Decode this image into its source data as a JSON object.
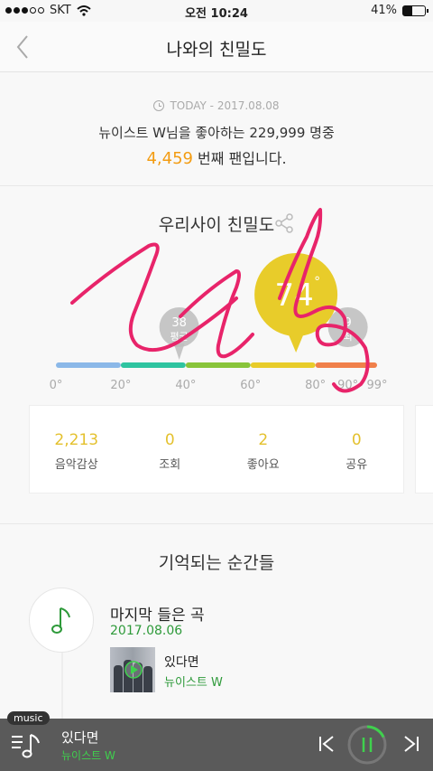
{
  "status_bar": {
    "carrier": "SKT",
    "time": "오전 10:24",
    "battery": "41%",
    "battery_level": 0.41
  },
  "nav": {
    "title": "나와의 친밀도",
    "back_icon": "back-icon"
  },
  "today": {
    "date": "TODAY - 2017.08.08",
    "line1": "뉴이스트 W님을 좋아하는 229,999 명중",
    "rank": "4,459",
    "line2_suffix": " 번째 팬입니다."
  },
  "intimacy": {
    "title": "우리사이 친밀도",
    "score": "74",
    "score_value": 74,
    "average": "38",
    "average_value": 38,
    "average_label": "평균",
    "top_value": 90,
    "top_text": "9",
    "top_label": "최",
    "ticks": [
      "0°",
      "20°",
      "40°",
      "60°",
      "80°",
      "90°",
      "99°"
    ],
    "tick_values": [
      0,
      20,
      40,
      60,
      80,
      90,
      99
    ],
    "segments": [
      {
        "color": "#8bb8e8",
        "to": 20
      },
      {
        "color": "#2ec4a0",
        "to": 40
      },
      {
        "color": "#88c43a",
        "to": 60
      },
      {
        "color": "#e8cc2a",
        "to": 80
      },
      {
        "color": "#f0804a",
        "to": 99
      }
    ],
    "bubble_color": "#e8cc2a"
  },
  "stats": [
    {
      "value": "2,213",
      "label": "음악감상"
    },
    {
      "value": "0",
      "label": "조회"
    },
    {
      "value": "2",
      "label": "좋아요"
    },
    {
      "value": "0",
      "label": "공유"
    }
  ],
  "moments": {
    "title": "기억되는 순간들",
    "label": "마지막 들은 곡",
    "date": "2017.08.06",
    "song_title": "있다면",
    "song_artist": "뉴이스트 W"
  },
  "player": {
    "tag": "music",
    "title": "있다면",
    "artist": "뉴이스트 W",
    "progress": 0.18
  }
}
